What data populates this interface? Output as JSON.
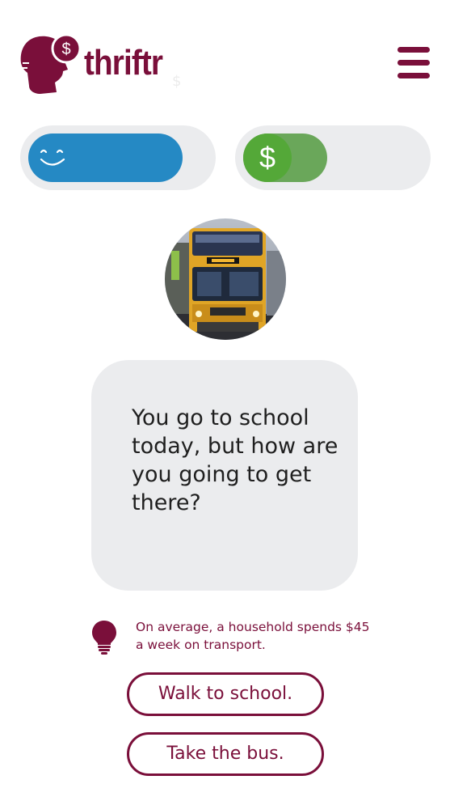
{
  "header": {
    "logo_text": "thriftr",
    "logo_icon": "head-with-dollar-icon",
    "faint_symbol": "$",
    "menu_icon": "hamburger-menu-icon"
  },
  "meters": {
    "happiness": {
      "icon": "smile-icon",
      "level": 0.86,
      "color": "#2589c4"
    },
    "money": {
      "icon": "dollar-icon",
      "symbol": "$",
      "level": 0.47,
      "color": "#6aa75a"
    }
  },
  "scenario": {
    "image_icon": "bus-photo",
    "question": "You go to school today, but how are you going to get there?"
  },
  "tip": {
    "icon": "lightbulb-icon",
    "text": "On average, a household spends $45 a week on transport."
  },
  "choices": [
    {
      "label": "Walk to school."
    },
    {
      "label": "Take the bus."
    }
  ],
  "colors": {
    "brand": "#7a0f3a",
    "card_background": "#ebecee",
    "happiness_blue": "#2589c4",
    "money_green": "#54a838"
  }
}
